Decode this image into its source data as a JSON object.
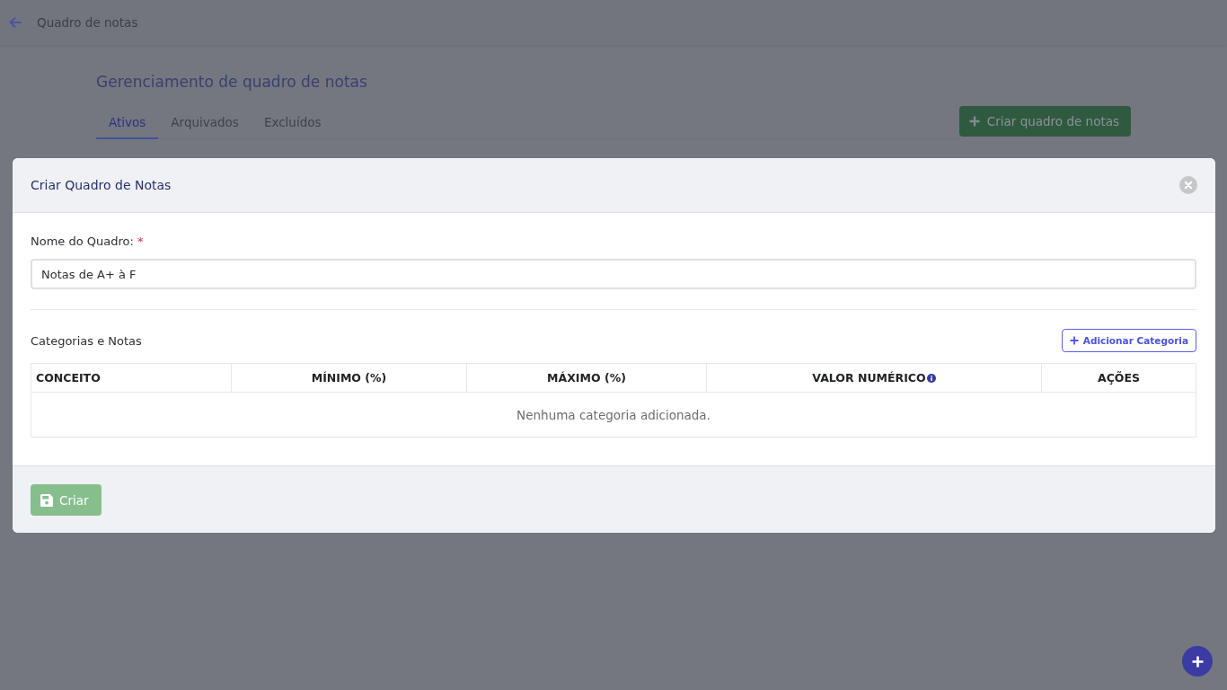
{
  "top_bar": {
    "title": "Quadro de notas"
  },
  "page": {
    "heading": "Gerenciamento de quadro de notas",
    "tabs": [
      {
        "label": "Ativos",
        "selected": true
      },
      {
        "label": "Arquivados",
        "selected": false
      },
      {
        "label": "Excluídos",
        "selected": false
      }
    ],
    "create_button": "Criar quadro de notas"
  },
  "modal": {
    "title": "Criar Quadro de Notas",
    "name_field": {
      "label": "Nome do Quadro:",
      "required_mark": "*",
      "value": "Notas de A+ à F"
    },
    "section_title": "Categorias e Notas",
    "add_button": "Adicionar Categoria",
    "table": {
      "columns": [
        {
          "label": "CONCEITO",
          "info": false
        },
        {
          "label": "MÍNIMO (%)",
          "info": false
        },
        {
          "label": "MÁXIMO (%)",
          "info": false
        },
        {
          "label": "VALOR NUMÉRICO",
          "info": true
        },
        {
          "label": "AÇÕES",
          "info": false
        }
      ],
      "empty_message": "Nenhuma categoria adicionada."
    },
    "submit_button": {
      "label": "Criar",
      "disabled": true
    }
  }
}
